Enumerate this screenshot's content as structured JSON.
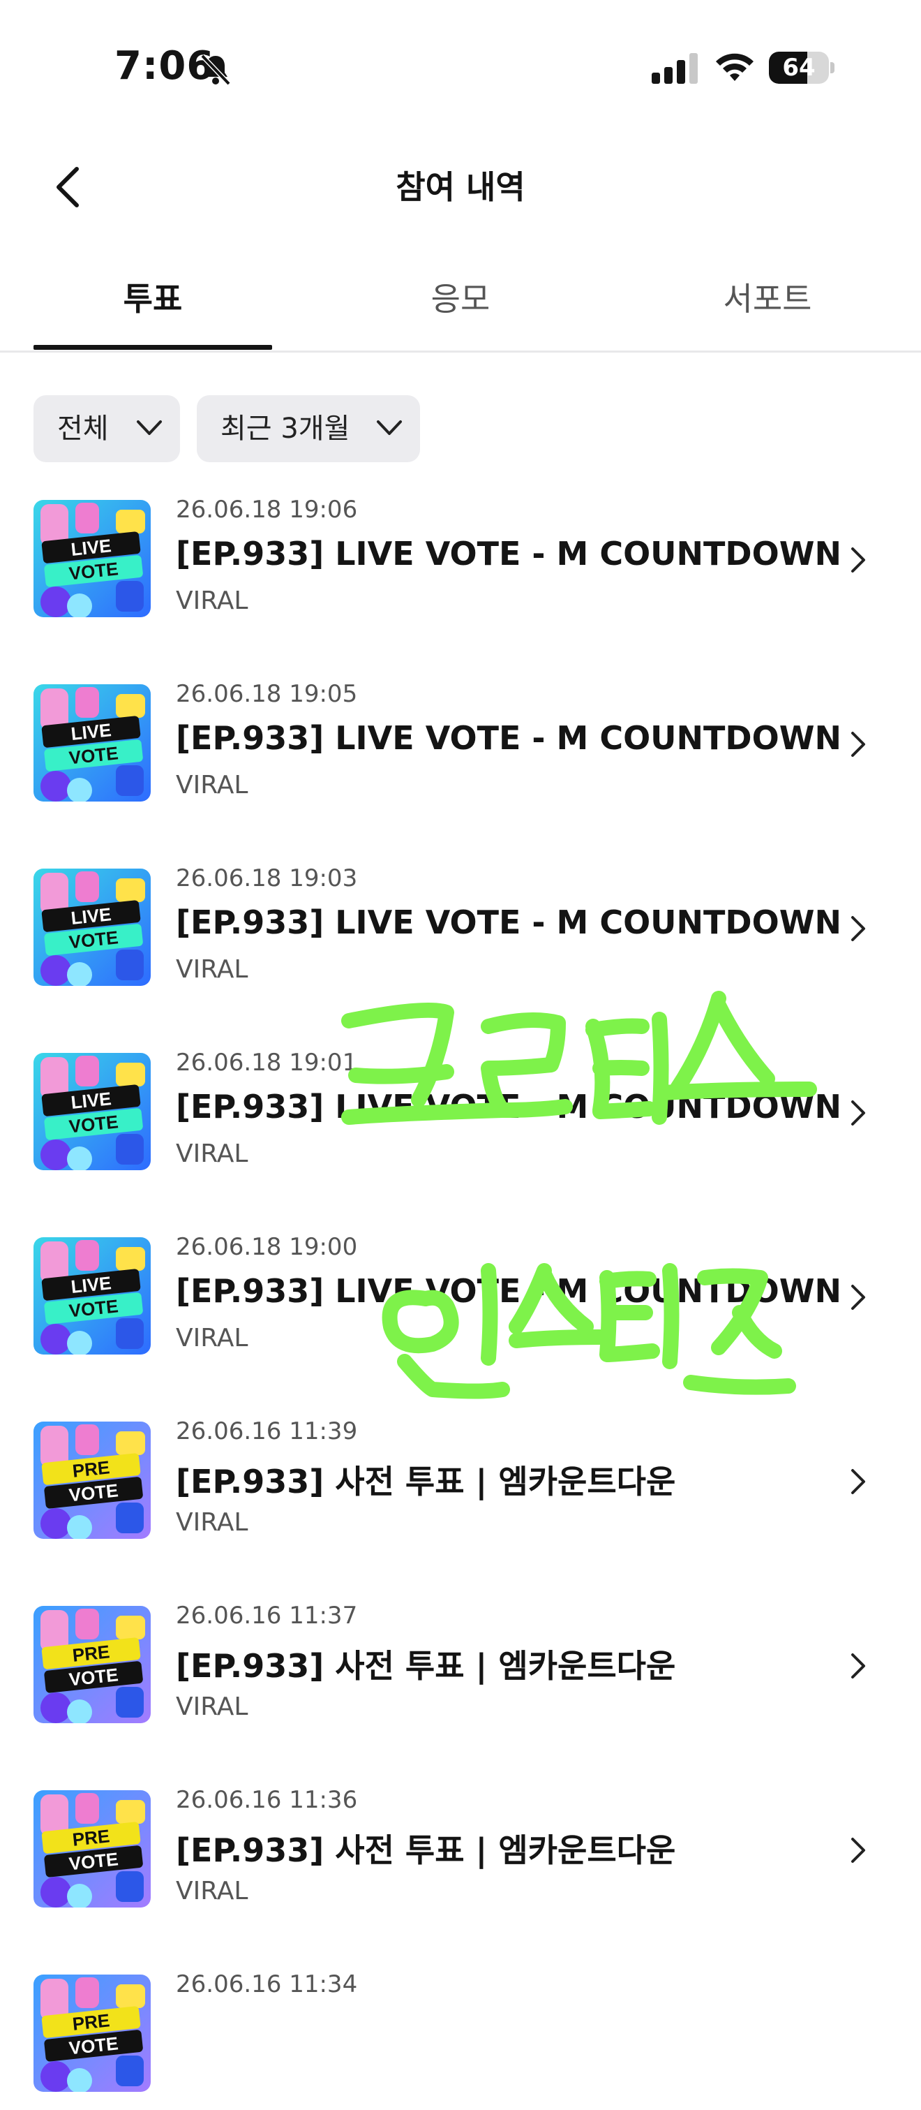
{
  "status_bar": {
    "time": "7:06",
    "battery": "64",
    "battery_level": 0.64
  },
  "header": {
    "title": "참여 내역"
  },
  "tabs": [
    {
      "label": "투표",
      "active": true
    },
    {
      "label": "응모",
      "active": false
    },
    {
      "label": "서포트",
      "active": false
    }
  ],
  "filters": {
    "scope": "전체",
    "period": "최근 3개월"
  },
  "items": [
    {
      "date": "26.06.18 19:06",
      "title": "[EP.933] LIVE VOTE - M COUNTDOWN",
      "sub": "VIRAL",
      "badge_top": "LIVE",
      "badge_bottom": "VOTE"
    },
    {
      "date": "26.06.18 19:05",
      "title": "[EP.933] LIVE VOTE - M COUNTDOWN",
      "sub": "VIRAL",
      "badge_top": "LIVE",
      "badge_bottom": "VOTE"
    },
    {
      "date": "26.06.18 19:03",
      "title": "[EP.933] LIVE VOTE - M COUNTDOWN",
      "sub": "VIRAL",
      "badge_top": "LIVE",
      "badge_bottom": "VOTE"
    },
    {
      "date": "26.06.18 19:01",
      "title": "[EP.933] LIVE VOTE - M COUNTDOWN",
      "sub": "VIRAL",
      "badge_top": "LIVE",
      "badge_bottom": "VOTE"
    },
    {
      "date": "26.06.18 19:00",
      "title": "[EP.933] LIVE VOTE - M COUNTDOWN",
      "sub": "VIRAL",
      "badge_top": "LIVE",
      "badge_bottom": "VOTE"
    },
    {
      "date": "26.06.16 11:39",
      "title": "[EP.933] 사전 투표 | 엠카운트다운",
      "sub": "VIRAL",
      "badge_top": "PRE",
      "badge_bottom": "VOTE"
    },
    {
      "date": "26.06.16 11:37",
      "title": "[EP.933] 사전 투표 | 엠카운트다운",
      "sub": "VIRAL",
      "badge_top": "PRE",
      "badge_bottom": "VOTE"
    },
    {
      "date": "26.06.16 11:36",
      "title": "[EP.933] 사전 투표 | 엠카운트다운",
      "sub": "VIRAL",
      "badge_top": "PRE",
      "badge_bottom": "VOTE"
    },
    {
      "date": "26.06.16 11:34",
      "title": "",
      "sub": "",
      "badge_top": "PRE",
      "badge_bottom": "VOTE"
    }
  ],
  "colors": {
    "accent_text": "#141414",
    "chip_bg": "#ececef",
    "scribble": "#7ef24a"
  }
}
